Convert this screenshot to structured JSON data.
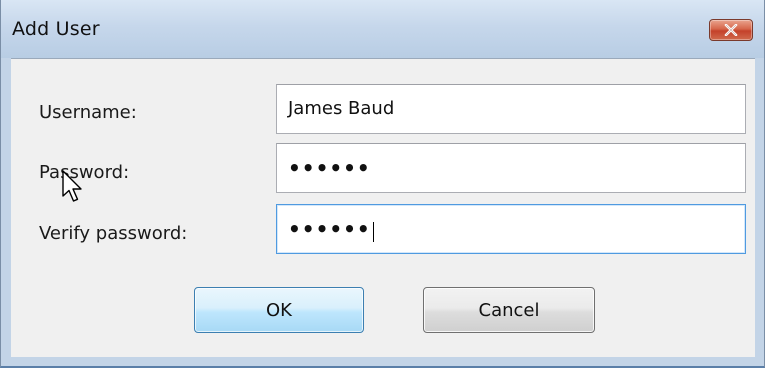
{
  "window": {
    "title": "Add User",
    "close_icon": "close-x-icon"
  },
  "form": {
    "username_label": "Username:",
    "username_value": "James Baud",
    "password_label": "Password:",
    "password_value": "••••••",
    "verify_label": "Verify password:",
    "verify_value": "••••••"
  },
  "buttons": {
    "ok_label": "OK",
    "cancel_label": "Cancel"
  },
  "pointer": {
    "icon": "mouse-pointer-icon"
  },
  "colors": {
    "titlebar": "#c6d7eb",
    "close_button": "#c4412a",
    "focus_border": "#4f9ae0",
    "default_button": "#bee6fd"
  }
}
